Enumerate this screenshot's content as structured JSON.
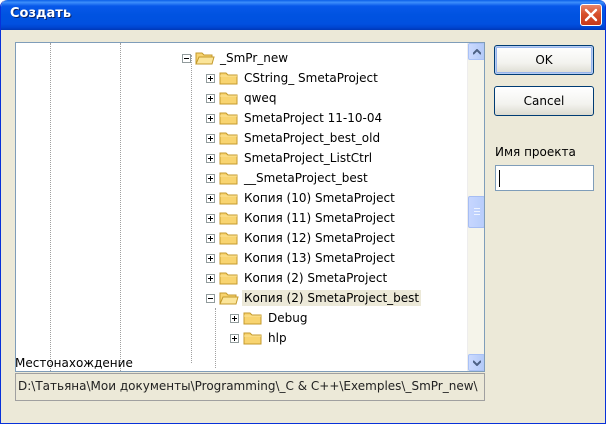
{
  "window": {
    "title": "Создать",
    "close_icon": "close-icon"
  },
  "tree": {
    "root": {
      "label": "_SmPr_new",
      "expanded": true
    },
    "children": [
      {
        "label": "CString_ SmetaProject",
        "expanded": false
      },
      {
        "label": "qweq",
        "expanded": false
      },
      {
        "label": "SmetaProject 11-10-04",
        "expanded": false
      },
      {
        "label": "SmetaProject_best_old",
        "expanded": false
      },
      {
        "label": "SmetaProject_ListCtrl",
        "expanded": false
      },
      {
        "label": "__SmetaProject_best",
        "expanded": false
      },
      {
        "label": "Копия (10) SmetaProject",
        "expanded": false
      },
      {
        "label": "Копия (11) SmetaProject",
        "expanded": false
      },
      {
        "label": "Копия (12) SmetaProject",
        "expanded": false
      },
      {
        "label": "Копия (13) SmetaProject",
        "expanded": false
      },
      {
        "label": "Копия (2) SmetaProject",
        "expanded": false
      },
      {
        "label": "Копия (2) SmetaProject_best",
        "expanded": true,
        "selected": true
      }
    ],
    "grandchildren": [
      {
        "label": "Debug",
        "expanded": false
      },
      {
        "label": "hlp",
        "expanded": false
      }
    ]
  },
  "buttons": {
    "ok_label": "OK",
    "cancel_label": "Cancel"
  },
  "project": {
    "label": "Имя проекта",
    "value": ""
  },
  "location": {
    "label": "Местонахождение",
    "path": "D:\\Татьяна\\Мои документы\\Programming\\_C & C++\\Exemples\\_SmPr_new\\"
  },
  "colors": {
    "folder": "#f8d470",
    "titlebar": "#0053e1",
    "dialog_bg": "#ece9d8"
  }
}
